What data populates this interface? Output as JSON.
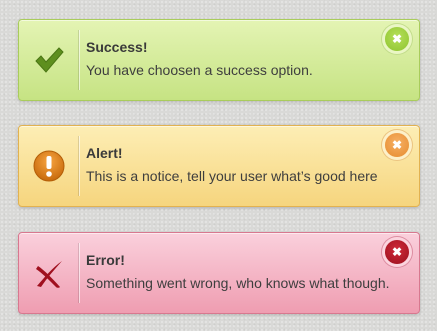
{
  "alerts": [
    {
      "type": "success",
      "icon": "checkmark-icon",
      "title": "Success!",
      "message": "You have choosen a success option.",
      "close_glyph": "✖",
      "accent": "#8dc32e"
    },
    {
      "type": "alert",
      "icon": "exclamation-icon",
      "title": "Alert!",
      "message": "This is a notice, tell your user what’s good here",
      "close_glyph": "✖",
      "accent": "#e68b2e"
    },
    {
      "type": "error",
      "icon": "cross-icon",
      "title": "Error!",
      "message": "Something went wrong, who knows what though.",
      "close_glyph": "✖",
      "accent": "#9a0f1d"
    }
  ]
}
